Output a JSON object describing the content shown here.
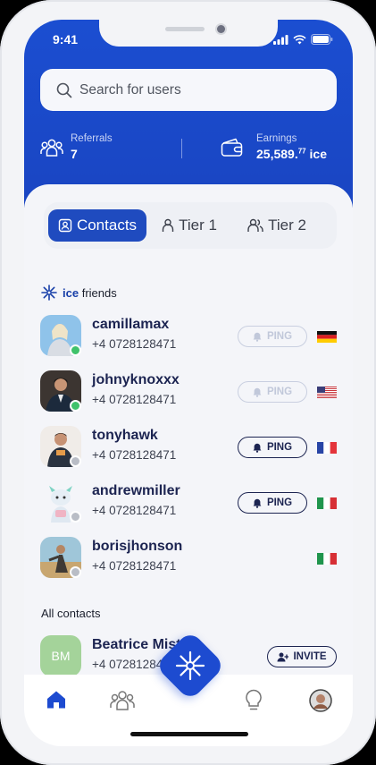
{
  "status_bar": {
    "time": "9:41"
  },
  "search": {
    "placeholder": "Search for users"
  },
  "stats": {
    "referrals_label": "Referrals",
    "referrals_value": "7",
    "earnings_label": "Earnings",
    "earnings_main": "25,589.",
    "earnings_decimals": "77",
    "earnings_unit": "ice"
  },
  "tabs": [
    {
      "label": "Contacts",
      "active": true
    },
    {
      "label": "Tier 1",
      "active": false
    },
    {
      "label": "Tier 2",
      "active": false
    }
  ],
  "ice_friends": {
    "title_bold": "ice",
    "title_rest": "friends",
    "items": [
      {
        "name": "camillamax",
        "phone": "+4 0728128471",
        "status": "online",
        "ping_label": "PING",
        "ping_enabled": false,
        "flag": "de"
      },
      {
        "name": "johnyknoxxx",
        "phone": "+4 0728128471",
        "status": "online",
        "ping_label": "PING",
        "ping_enabled": false,
        "flag": "us"
      },
      {
        "name": "tonyhawk",
        "phone": "+4 0728128471",
        "status": "offline",
        "ping_label": "PING",
        "ping_enabled": true,
        "flag": "fr"
      },
      {
        "name": "andrewmiller",
        "phone": "+4 0728128471",
        "status": "offline",
        "ping_label": "PING",
        "ping_enabled": true,
        "flag": "it"
      },
      {
        "name": "borisjhonson",
        "phone": "",
        "status": "offline",
        "ping_label": "",
        "ping_enabled": false,
        "flag": "it"
      }
    ]
  },
  "all_contacts": {
    "title": "All contacts",
    "items": [
      {
        "initials": "BM",
        "name": "Beatrice Mistral",
        "phone": "+4 0728128471",
        "invite_label": "INVITE"
      }
    ]
  },
  "colors": {
    "brand_blue": "#1b4ed1",
    "navy_text": "#1c2451",
    "online": "#3fc26b",
    "offline": "#b9bdc6"
  },
  "tabbar": {
    "items": [
      "home-icon",
      "team-icon",
      "ice-logo-icon",
      "bulb-icon",
      "profile-icon"
    ]
  }
}
